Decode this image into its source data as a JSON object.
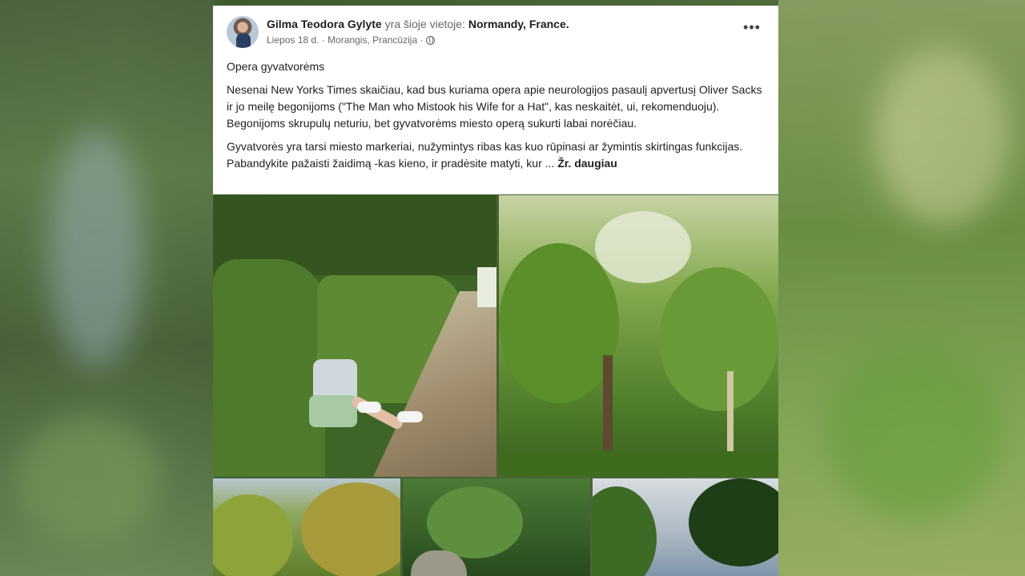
{
  "post": {
    "author": "Gilma Teodora Gylyte",
    "location_prefix": "yra šioje vietoje:",
    "location": "Normandy, France.",
    "date": "Liepos 18 d.",
    "place_detail": "· Morangis, Prancūzija ·",
    "privacy_icon": "globe-icon",
    "more_icon": "•••",
    "title": "Opera gyvatvorėms",
    "paragraph1": "Nesenai New Yorks Times skaičiau, kad bus kuriama opera apie neurologijos pasaulį apvertusį Oliver Sacks ir jo meilę begonijoms (\"The Man who Mistook his Wife for a Hat\", kas neskaitėt, ui, rekomenduoju). Begonijoms skrupulų neturiu, bet gyvatvorėms miesto operą sukurti labai norėčiau.",
    "paragraph2": "Gyvatvorės yra tarsi miesto markeriai, nužymintys ribas kas kuo rūpinasi ar žymintis skirtingas funkcijas. Pabandykite pažaisti žaidimą -kas kieno, ir pradėsite matyti, kur ...",
    "see_more": "Žr. daugiau"
  },
  "photos": [
    {
      "name": "hedge-path-photo"
    },
    {
      "name": "tree-canopy-photo"
    },
    {
      "name": "yellow-trees-photo"
    },
    {
      "name": "green-shrub-photo"
    },
    {
      "name": "sky-trees-photo"
    }
  ],
  "colors": {
    "text": "#1c1e21",
    "secondary_text": "#65676b",
    "card_bg": "#ffffff"
  }
}
